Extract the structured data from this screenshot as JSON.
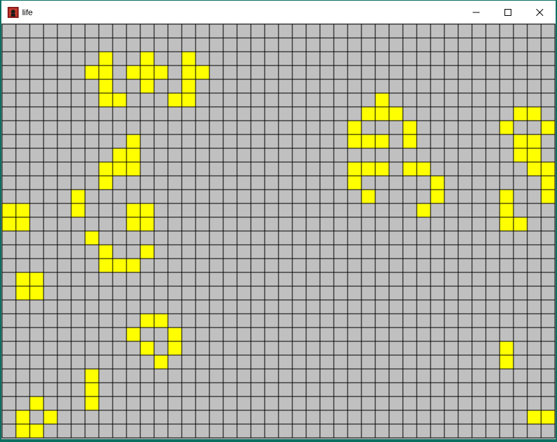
{
  "window": {
    "title": "life",
    "icon": "app-icon",
    "controls": [
      "minimize-icon",
      "maximize-icon",
      "close-icon"
    ]
  },
  "board": {
    "columns": 40,
    "rows": 30,
    "colors": {
      "dead": "#c0c0c0",
      "alive": "#ffff00",
      "grid": "#000000"
    },
    "alive_cells": [
      [
        7,
        2
      ],
      [
        10,
        2
      ],
      [
        13,
        2
      ],
      [
        6,
        3
      ],
      [
        7,
        3
      ],
      [
        9,
        3
      ],
      [
        10,
        3
      ],
      [
        11,
        3
      ],
      [
        13,
        3
      ],
      [
        14,
        3
      ],
      [
        7,
        4
      ],
      [
        10,
        4
      ],
      [
        13,
        4
      ],
      [
        7,
        5
      ],
      [
        8,
        5
      ],
      [
        12,
        5
      ],
      [
        13,
        5
      ],
      [
        27,
        5
      ],
      [
        26,
        6
      ],
      [
        27,
        6
      ],
      [
        28,
        6
      ],
      [
        37,
        6
      ],
      [
        38,
        6
      ],
      [
        25,
        7
      ],
      [
        29,
        7
      ],
      [
        36,
        7
      ],
      [
        39,
        7
      ],
      [
        9,
        8
      ],
      [
        25,
        8
      ],
      [
        26,
        8
      ],
      [
        27,
        8
      ],
      [
        29,
        8
      ],
      [
        37,
        8
      ],
      [
        38,
        8
      ],
      [
        8,
        9
      ],
      [
        9,
        9
      ],
      [
        37,
        9
      ],
      [
        38,
        9
      ],
      [
        7,
        10
      ],
      [
        8,
        10
      ],
      [
        9,
        10
      ],
      [
        25,
        10
      ],
      [
        26,
        10
      ],
      [
        27,
        10
      ],
      [
        29,
        10
      ],
      [
        30,
        10
      ],
      [
        38,
        10
      ],
      [
        39,
        10
      ],
      [
        7,
        11
      ],
      [
        25,
        11
      ],
      [
        31,
        11
      ],
      [
        39,
        11
      ],
      [
        5,
        12
      ],
      [
        26,
        12
      ],
      [
        31,
        12
      ],
      [
        36,
        12
      ],
      [
        39,
        12
      ],
      [
        0,
        13
      ],
      [
        1,
        13
      ],
      [
        5,
        13
      ],
      [
        9,
        13
      ],
      [
        10,
        13
      ],
      [
        30,
        13
      ],
      [
        36,
        13
      ],
      [
        0,
        14
      ],
      [
        1,
        14
      ],
      [
        9,
        14
      ],
      [
        10,
        14
      ],
      [
        36,
        14
      ],
      [
        37,
        14
      ],
      [
        6,
        15
      ],
      [
        7,
        16
      ],
      [
        10,
        16
      ],
      [
        7,
        17
      ],
      [
        8,
        17
      ],
      [
        9,
        17
      ],
      [
        1,
        18
      ],
      [
        2,
        18
      ],
      [
        1,
        19
      ],
      [
        2,
        19
      ],
      [
        10,
        21
      ],
      [
        11,
        21
      ],
      [
        9,
        22
      ],
      [
        12,
        22
      ],
      [
        10,
        23
      ],
      [
        12,
        23
      ],
      [
        36,
        23
      ],
      [
        11,
        24
      ],
      [
        36,
        24
      ],
      [
        6,
        25
      ],
      [
        6,
        26
      ],
      [
        2,
        27
      ],
      [
        6,
        27
      ],
      [
        1,
        28
      ],
      [
        3,
        28
      ],
      [
        38,
        28
      ],
      [
        39,
        28
      ],
      [
        1,
        29
      ],
      [
        2,
        29
      ]
    ]
  }
}
